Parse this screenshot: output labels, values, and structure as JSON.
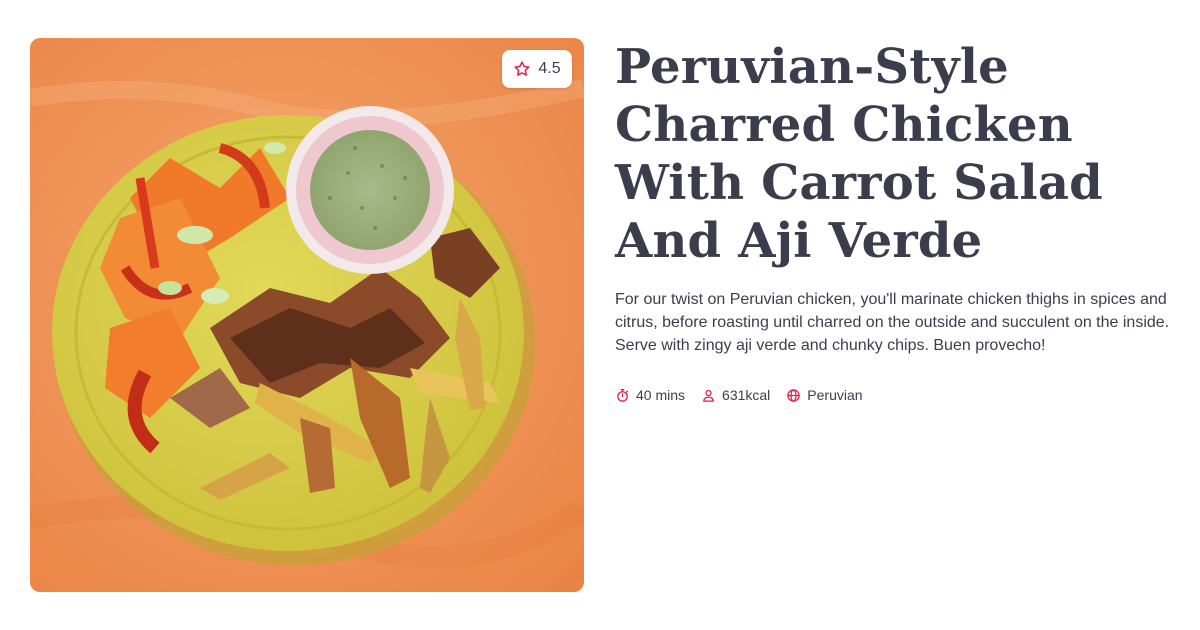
{
  "recipe": {
    "title": "Peruvian-Style Charred Chicken With Carrot Salad And Aji Verde",
    "description": "For our twist on Peruvian chicken, you'll marinate chicken thighs in spices and citrus, before roasting until charred on the outside and succulent on the inside. Serve with zingy aji verde and chunky chips. Buen provecho!",
    "rating": "4.5",
    "image_alt": "Plate of charred chicken, carrot salad, potato wedges and aji verde dip on an orange background",
    "meta": {
      "time": "40 mins",
      "calories": "631kcal",
      "cuisine": "Peruvian"
    }
  },
  "icons": {
    "rating": "star-outline-icon",
    "time": "stopwatch-icon",
    "calories": "person-icon",
    "cuisine": "globe-icon"
  },
  "colors": {
    "accent": "#e11d48",
    "text": "#3c3c4c",
    "photo_background": "#f0965a",
    "plate": "#d8cf4a"
  }
}
